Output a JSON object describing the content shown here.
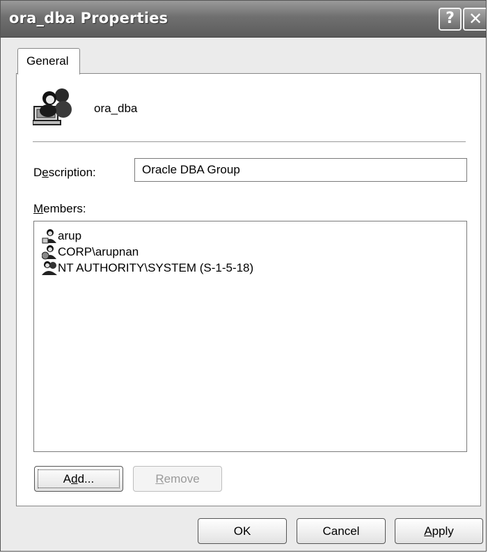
{
  "window": {
    "title": "ora_dba Properties",
    "help_label": "?",
    "close_label": "✕"
  },
  "tabs": [
    {
      "label": "General"
    }
  ],
  "group": {
    "name": "ora_dba"
  },
  "description": {
    "label": "Description:",
    "value": "Oracle DBA Group"
  },
  "members": {
    "label": "Members:",
    "items": [
      {
        "name": "arup",
        "icon": "user-icon"
      },
      {
        "name": "CORP\\arupnan",
        "icon": "domain-user-icon"
      },
      {
        "name": "NT AUTHORITY\\SYSTEM (S-1-5-18)",
        "icon": "system-user-icon"
      }
    ]
  },
  "buttons": {
    "add": "Add...",
    "remove": "Remove",
    "ok": "OK",
    "cancel": "Cancel",
    "apply": "Apply"
  },
  "colors": {
    "titlebar": "#6f6f6f",
    "panel": "#ffffff",
    "dialog_bg": "#ebebeb"
  }
}
